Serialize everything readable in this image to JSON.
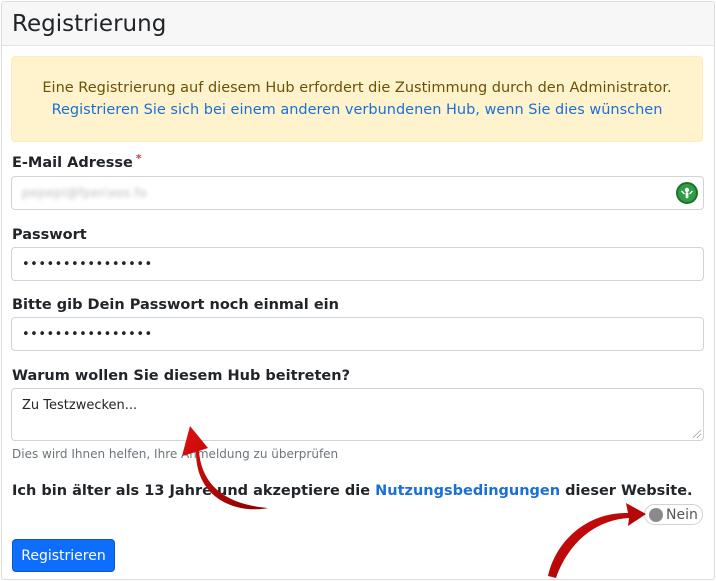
{
  "header": {
    "title": "Registrierung"
  },
  "alert": {
    "line1": "Eine Registrierung auf diesem Hub erfordert die Zustimmung durch den Administrator.",
    "line2": "Registrieren Sie sich bei einem anderen verbundenen Hub, wenn Sie dies wünschen"
  },
  "email": {
    "label": "E-Mail Adresse",
    "required_mark": "*",
    "value": "pepepl@fperixos.fo",
    "status_icon": "shield-check-icon"
  },
  "password": {
    "label": "Passwort",
    "value": "••••••••••••••••"
  },
  "password_confirm": {
    "label": "Bitte gib Dein Passwort noch einmal ein",
    "value": "••••••••••••••••"
  },
  "reason": {
    "label": "Warum wollen Sie diesem Hub beitreten?",
    "value": "Zu Testzwecken...",
    "help": "Dies wird Ihnen helfen, Ihre Anmeldung zu überprüfen"
  },
  "terms": {
    "prefix": "Ich bin älter als 13 Jahre und akzeptiere die ",
    "link": "Nutzungsbedingungen",
    "suffix": " dieser Website.",
    "toggle_label": "Nein"
  },
  "submit": {
    "label": "Registrieren"
  },
  "colors": {
    "primary": "#0d6efd",
    "alert_bg": "#fff3cd",
    "arrow": "#c00000"
  }
}
